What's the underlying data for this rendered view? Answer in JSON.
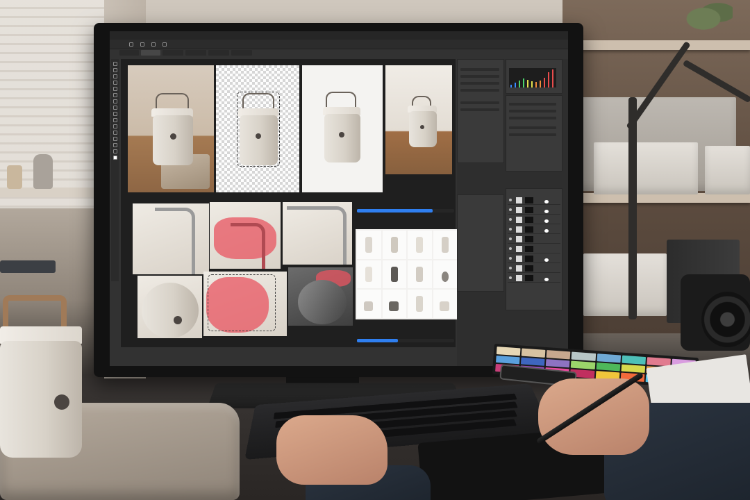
{
  "scene": {
    "description_colors": {
      "accent_blue": "#2f7ff0",
      "mask_red": "#e85460",
      "product_cream": "#e2ddd4"
    }
  },
  "photoshop": {
    "menu": [
      "",
      "",
      "",
      "",
      "",
      "",
      "",
      "",
      "",
      "",
      ""
    ],
    "progress_top_value": 0.78,
    "progress_bottom_value": 0.42
  },
  "color_swatches": [
    "#e6d7b5",
    "#d8c3a2",
    "#c8a88e",
    "#b7c6c7",
    "#6fa9d4",
    "#4ec0b8",
    "#e17b8f",
    "#d99de0",
    "#5aa0dd",
    "#3e66bf",
    "#8d73c2",
    "#9bd46a",
    "#4eb85a",
    "#d7d84c",
    "#e9a24b",
    "#e36f51",
    "#c83f7a",
    "#9a4bc3",
    "#e64b9e",
    "#c12f5f",
    "#f0c53b",
    "#f26a3b",
    "#59c3e6",
    "#2d9c76"
  ]
}
